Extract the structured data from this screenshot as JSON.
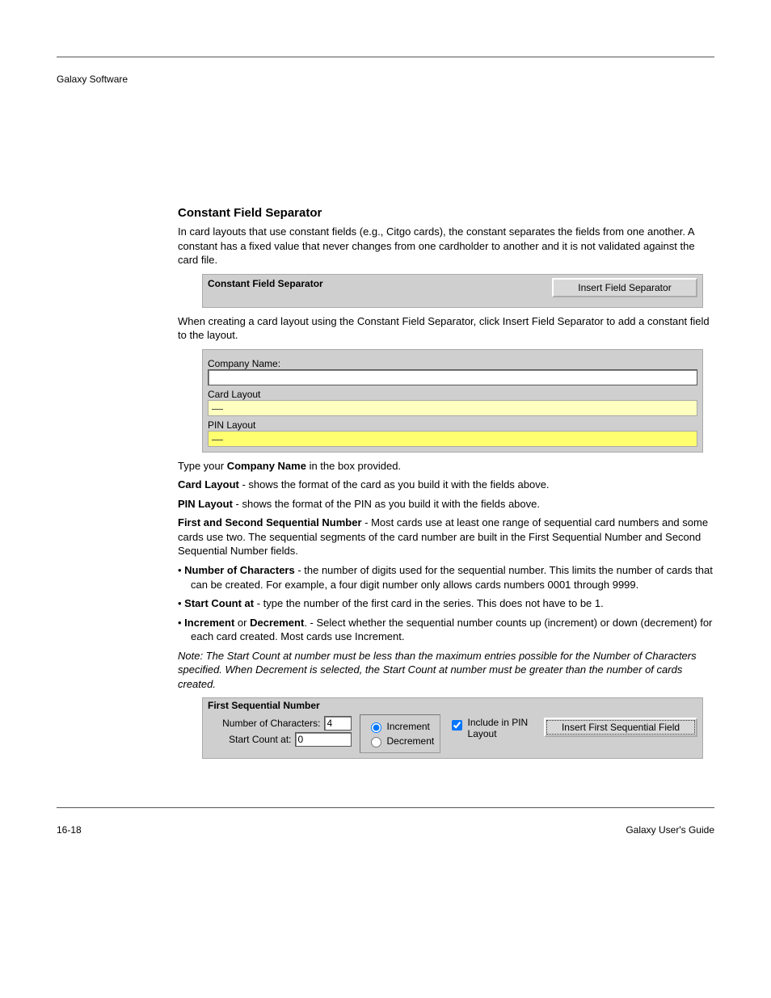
{
  "header": {
    "left": "Galaxy Software",
    "right": ""
  },
  "intro_top": " ",
  "constant_separator": {
    "heading": "Constant Field Separator",
    "body": "In card layouts that use constant fields (e.g., Citgo cards), the constant separates the fields from one another. A constant has a fixed value that never changes from one cardholder to another and it is not validated against the card file.",
    "panel_title": "Constant Field Separator",
    "insert_button": "Insert  Field Separator",
    "after": "When creating a card layout using the Constant Field Separator, click Insert Field Separator to add a constant field to the layout."
  },
  "company_panel": {
    "company_label": "Company Name:",
    "company_value": "",
    "card_layout_label": "Card Layout",
    "card_layout_value": "—",
    "pin_layout_label": "PIN Layout",
    "pin_layout_value": "—"
  },
  "company_section": {
    "company_name_line": "Type your <b>Company Name</b> in the box provided.",
    "card_layout_line": "<b>Card Layout</b> - shows the format of the card as you build it with the fields above.",
    "pin_layout_line": "<b>PIN Layout</b> - shows the format of the PIN as you build it with the fields above.",
    "seq_lead": "<b>First and Second Sequential Number</b> - Most cards use at least one range of sequential card numbers and some cards use two. The sequential segments of the card number are built in the First Sequential Number and Second Sequential Number fields.",
    "bullets": [
      "<b>Number of Characters</b> - the number of digits used for the sequential number.  This limits the number of cards that can be created.  For example, a four digit number only allows cards numbers 0001 through 9999.",
      "<b>Start Count at</b> - type the number of the first card in the series.  This does not have to be 1.",
      "<b>Increment</b> or <b>Decrement</b>. - Select whether the sequential number counts up (increment) or down (decrement) for each card created.  Most cards use Increment."
    ],
    "note": "Note: The Start Count at number must be less than the maximum entries possible for the Number of Characters specified.  When Decrement is selected, the Start Count at number must be greater than the number of cards created."
  },
  "seq_panel": {
    "title": "First Sequential Number",
    "num_chars_label": "Number of Characters:",
    "num_chars_value": "4",
    "start_label": "Start Count at:",
    "start_value": "0",
    "increment_label": "Increment",
    "decrement_label": "Decrement",
    "include_label": "Include in PIN Layout",
    "include_checked": true,
    "radio_selected": "increment",
    "insert_button": "Insert First Sequential Field"
  },
  "footer": {
    "left": "16-18",
    "right": "Galaxy User's Guide"
  }
}
